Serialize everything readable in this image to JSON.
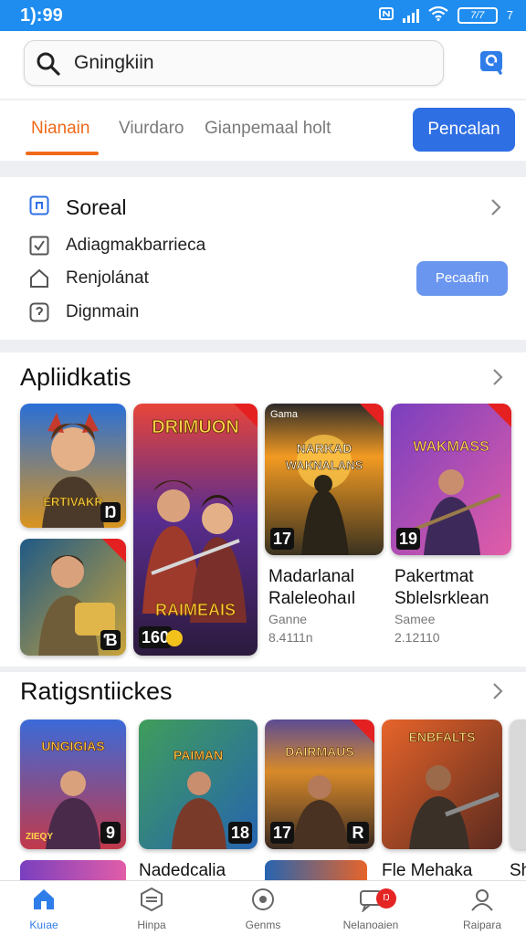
{
  "status_bar": {
    "time": "1):99",
    "battery": "7/7",
    "battery_tail": "7"
  },
  "search": {
    "value": "Gningkiin"
  },
  "tabs": {
    "items": [
      {
        "label": "Nianain"
      },
      {
        "label": "Viurdaro"
      },
      {
        "label": "Gianpemaal holt"
      }
    ],
    "action_label": "Pencalan"
  },
  "account": {
    "title": "Soreal",
    "rows": [
      {
        "label": "Adiagmakbarrieca"
      },
      {
        "label": "Renjolánat"
      },
      {
        "label": "Dignmain"
      }
    ],
    "action_label": "Pecaafin"
  },
  "apps_section": {
    "title": "Apliidkatis",
    "tiles": [
      {
        "art_text": "ERTIVAKR",
        "badge": "Ŋ",
        "colors": [
          "#2a6fd6",
          "#d9941f"
        ]
      },
      {
        "art_text": "",
        "badge": "Ɓ",
        "colors": [
          "#1f5a86",
          "#c9a33a"
        ]
      },
      {
        "art_text": "DRIMUON",
        "art_text_2": "RAIMEAIS",
        "badge": "160",
        "colors": [
          "#e8453a",
          "#5a2d8f"
        ]
      },
      {
        "art_text": "NARKAD WAKNALANS",
        "badge": "17",
        "corner_label": "Gama",
        "colors": [
          "#f29a22",
          "#2c2a29"
        ]
      },
      {
        "art_text": "WAKMASS",
        "badge": "19",
        "colors": [
          "#7a3fbf",
          "#e25da8"
        ]
      }
    ],
    "games": [
      {
        "title_1": "Madarlanal",
        "title_2": "Raleleohaıl",
        "sub_1": "Ganne",
        "sub_2": "8.4111n"
      },
      {
        "title_1": "Pakertmat",
        "title_2": "Sblelsrklean",
        "sub_1": "Samee",
        "sub_2": "2.12110"
      }
    ]
  },
  "ratings_section": {
    "title": "Ratigsntiickes",
    "tiles": [
      {
        "art_text": "UNGIGIAS",
        "badge": "9",
        "footer": "ZIEQY",
        "colors": [
          "#3b6ad8",
          "#c2394b"
        ]
      },
      {
        "art_text": "PAIMAN",
        "badge": "18",
        "colors": [
          "#3f9d5a",
          "#2664b0"
        ]
      },
      {
        "art_text": "DAIRMAUS",
        "badge": "17",
        "colors": [
          "#d88a2a",
          "#5c4b93"
        ]
      },
      {
        "art_text": "ENBFALTS",
        "badge": "R",
        "colors": [
          "#e7642a",
          "#5a2a1f"
        ]
      }
    ],
    "peek": [
      {
        "title": "Nadedcalia"
      },
      {
        "title": "Fle Mehaka"
      },
      {
        "title": "Sh"
      }
    ]
  },
  "bottom_nav": {
    "items": [
      {
        "label": "Kuıae",
        "active": true
      },
      {
        "label": "Hinpa"
      },
      {
        "label": "Genms"
      },
      {
        "label": "Nelanoaien",
        "badge": "Ŋ"
      },
      {
        "label": "Raipara"
      }
    ]
  }
}
